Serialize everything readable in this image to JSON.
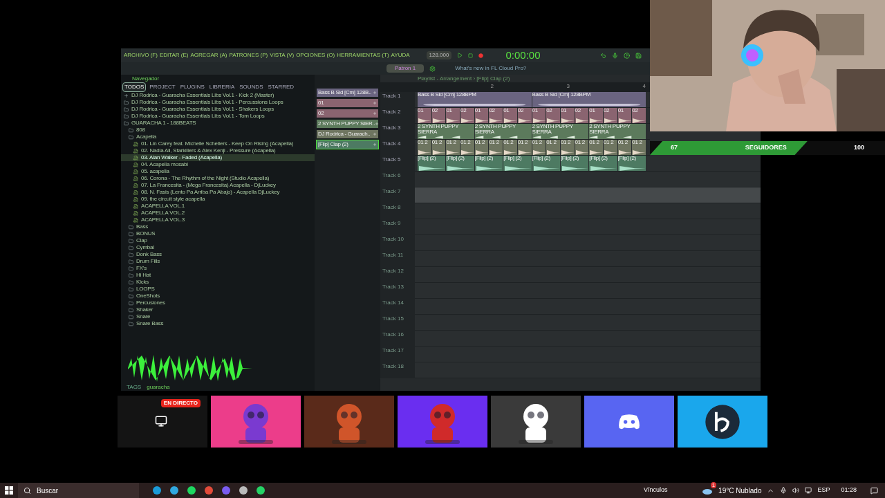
{
  "menu": [
    "ARCHIVO (F)",
    "EDITAR (E)",
    "AGREGAR (A)",
    "PATRONES (P)",
    "VISTA (V)",
    "OPCIONES (O)",
    "HERRAMIENTAS (T)",
    "AYUDA"
  ],
  "transport": {
    "tempo": "128.000",
    "time": "0:00:00",
    "pattern": "Patron 1",
    "news": "What's new in FL Cloud Pro?",
    "recording": true
  },
  "browser": {
    "title": "Navegador",
    "tabs": [
      {
        "label": "TODOS",
        "selected": true
      },
      {
        "label": "PROJECT",
        "selected": false
      },
      {
        "label": "PLUGINS",
        "selected": false
      },
      {
        "label": "LIBRERIA",
        "selected": false
      },
      {
        "label": "SOUNDS",
        "selected": false
      },
      {
        "label": "STARRED",
        "selected": false
      }
    ],
    "tree": [
      {
        "kind": "pack",
        "label": "DJ Rodrica - Guaracha Essentials Libs Vol.1 - Kick 2 (Master)",
        "selected": false
      },
      {
        "kind": "folder",
        "label": "DJ Rodrica - Guaracha Essentials Libs Vol.1 - Percussions Loops",
        "selected": false
      },
      {
        "kind": "folder",
        "label": "DJ Rodrica - Guaracha Essentials Libs Vol.1 - Shakers Loops",
        "selected": false
      },
      {
        "kind": "folder",
        "label": "DJ Rodrica - Guaracha Essentials Libs Vol.1 - Tom Loops",
        "selected": false
      },
      {
        "kind": "folder",
        "label": "GUARACHA 1 - 188BEATS",
        "selected": false,
        "children": [
          {
            "kind": "folder",
            "label": "808",
            "selected": false
          },
          {
            "kind": "folder",
            "label": "Acapella",
            "selected": false,
            "children": [
              {
                "kind": "file",
                "label": "01. Lin Carey feat. Michelle Schellers - Keep On Rising (Acapella)",
                "selected": false
              },
              {
                "kind": "file",
                "label": "02. Nadia Ali, Starkillers & Alex Kenji - Pressure (Acapella)",
                "selected": false
              },
              {
                "kind": "file",
                "label": "03. Alan Walker - Faded (Acapella)",
                "selected": true
              },
              {
                "kind": "file",
                "label": "04. Acapella mosabi",
                "selected": false
              },
              {
                "kind": "file",
                "label": "05. acapella",
                "selected": false
              },
              {
                "kind": "file",
                "label": "06. Corona - The Rhythm of the Night (Studio Acapella)",
                "selected": false
              },
              {
                "kind": "file",
                "label": "07. La Francesita - (Mega Francesita) Acapella - DjLuckey",
                "selected": false
              },
              {
                "kind": "file",
                "label": "08. N. Fasis (Lento Pa Arriba Pa Abajo) - Acapella DjLuckey",
                "selected": false
              },
              {
                "kind": "file",
                "label": "09. the circuit style acapella",
                "selected": false
              },
              {
                "kind": "file",
                "label": "ACAPELLA VOL.1",
                "selected": false
              },
              {
                "kind": "file",
                "label": "ACAPELLA VOL.2",
                "selected": false
              },
              {
                "kind": "file",
                "label": "ACAPELLA VOL.3",
                "selected": false
              }
            ]
          },
          {
            "kind": "folder",
            "label": "Bass",
            "selected": false
          },
          {
            "kind": "folder",
            "label": "BONUS",
            "selected": false
          },
          {
            "kind": "folder",
            "label": "Clap",
            "selected": false
          },
          {
            "kind": "folder",
            "label": "Cymbal",
            "selected": false
          },
          {
            "kind": "folder",
            "label": "Donk Bass",
            "selected": false
          },
          {
            "kind": "folder",
            "label": "Drum Fills",
            "selected": false
          },
          {
            "kind": "folder",
            "label": "FX's",
            "selected": false
          },
          {
            "kind": "folder",
            "label": "Hi Hat",
            "selected": false
          },
          {
            "kind": "folder",
            "label": "Kicks",
            "selected": false
          },
          {
            "kind": "folder",
            "label": "LOOPS",
            "selected": false
          },
          {
            "kind": "folder",
            "label": "OneShots",
            "selected": false
          },
          {
            "kind": "folder",
            "label": "Percusiones",
            "selected": false
          },
          {
            "kind": "folder",
            "label": "Shaker",
            "selected": false
          },
          {
            "kind": "folder",
            "label": "Snare",
            "selected": false
          },
          {
            "kind": "folder",
            "label": "Snare Bass",
            "selected": false
          }
        ]
      }
    ],
    "tags_label": "TAGS",
    "tag": "guaracha"
  },
  "channels": [
    {
      "label": "Bass B Sid [Cm] 128B..",
      "color": "#6a6480",
      "selected": false
    },
    {
      "label": "01",
      "color": "#8a6470",
      "selected": false
    },
    {
      "label": "02",
      "color": "#8a6470",
      "selected": false
    },
    {
      "label": "2 SYNTH PUPPY SIER..",
      "color": "#5c7a5c",
      "selected": false
    },
    {
      "label": "DJ Rodrica - Guarach..",
      "color": "#6e7560",
      "selected": false
    },
    {
      "label": "[Flip] Clap (2)",
      "color": "#4d7a62",
      "selected": true
    }
  ],
  "playlist": {
    "title": "Playlist - Arrangement › [Flip] Clap (2)",
    "ruler": [
      "2",
      "3",
      "4"
    ],
    "tracks": [
      {
        "name": "Track 1",
        "color": "#6a6480",
        "highlighted": false,
        "clips": [
          "Bass B Sid [Cm] 128BPM",
          "Bass B Sid [Cm] 128BPM"
        ]
      },
      {
        "name": "Track 2",
        "color": "#8a6470",
        "highlighted": false,
        "clips": [
          "01",
          "02",
          "01",
          "02",
          "01",
          "02",
          "01",
          "02",
          "01",
          "02",
          "01",
          "02",
          "01",
          "02",
          "01",
          "02"
        ]
      },
      {
        "name": "Track 3",
        "color": "#5c7a5c",
        "highlighted": false,
        "clips": [
          "2 SYNTH PUPPY SIERRA",
          "2 SYNTH PUPPY SIERRA",
          "2 SYNTH PUPPY SIERRA",
          "2 SYNTH PUPPY SIERRA"
        ]
      },
      {
        "name": "Track 4",
        "color": "#6e7560",
        "highlighted": false,
        "clips": [
          "01 2",
          "01 2",
          "01 2",
          "01 2",
          "01 2",
          "01 2",
          "01 2",
          "01 2",
          "01 2",
          "01 2",
          "01 2",
          "01 2",
          "01 2",
          "01 2",
          "01 2",
          "01 2"
        ]
      },
      {
        "name": "Track 5",
        "color": "#4d7a62",
        "highlighted": false,
        "clips": [
          "[Flip] (2)",
          "[Flip] (2)",
          "[Flip] (2)",
          "[Flip] (2)",
          "[Flip] (2)",
          "[Flip] (2)",
          "[Flip] (2)",
          "[Flip] (2)"
        ]
      },
      {
        "name": "Track 6",
        "highlighted": false
      },
      {
        "name": "Track 7",
        "highlighted": true
      },
      {
        "name": "Track 8",
        "highlighted": false
      },
      {
        "name": "Track 9",
        "highlighted": false
      },
      {
        "name": "Track 10",
        "highlighted": false
      },
      {
        "name": "Track 11",
        "highlighted": false
      },
      {
        "name": "Track 12",
        "highlighted": false
      },
      {
        "name": "Track 13",
        "highlighted": false
      },
      {
        "name": "Track 14",
        "highlighted": false
      },
      {
        "name": "Track 15",
        "highlighted": false
      },
      {
        "name": "Track 16",
        "highlighted": false
      },
      {
        "name": "Track 17",
        "highlighted": false
      },
      {
        "name": "Track 18",
        "highlighted": false
      }
    ]
  },
  "goal": {
    "current": "67",
    "label": "SEGUIDORES",
    "target": "100",
    "level": 0.67
  },
  "tiles": [
    {
      "kind": "preview",
      "badge": "EN DIRECTO"
    },
    {
      "kind": "picture"
    },
    {
      "kind": "picture"
    },
    {
      "kind": "picture"
    },
    {
      "kind": "picture"
    },
    {
      "kind": "discord"
    },
    {
      "kind": "logo"
    }
  ],
  "taskbar": {
    "search": "Buscar",
    "links": "Vínculos",
    "weather_badge": "1",
    "weather": "19°C Nublado",
    "language": "ESP",
    "time": "01:28"
  }
}
